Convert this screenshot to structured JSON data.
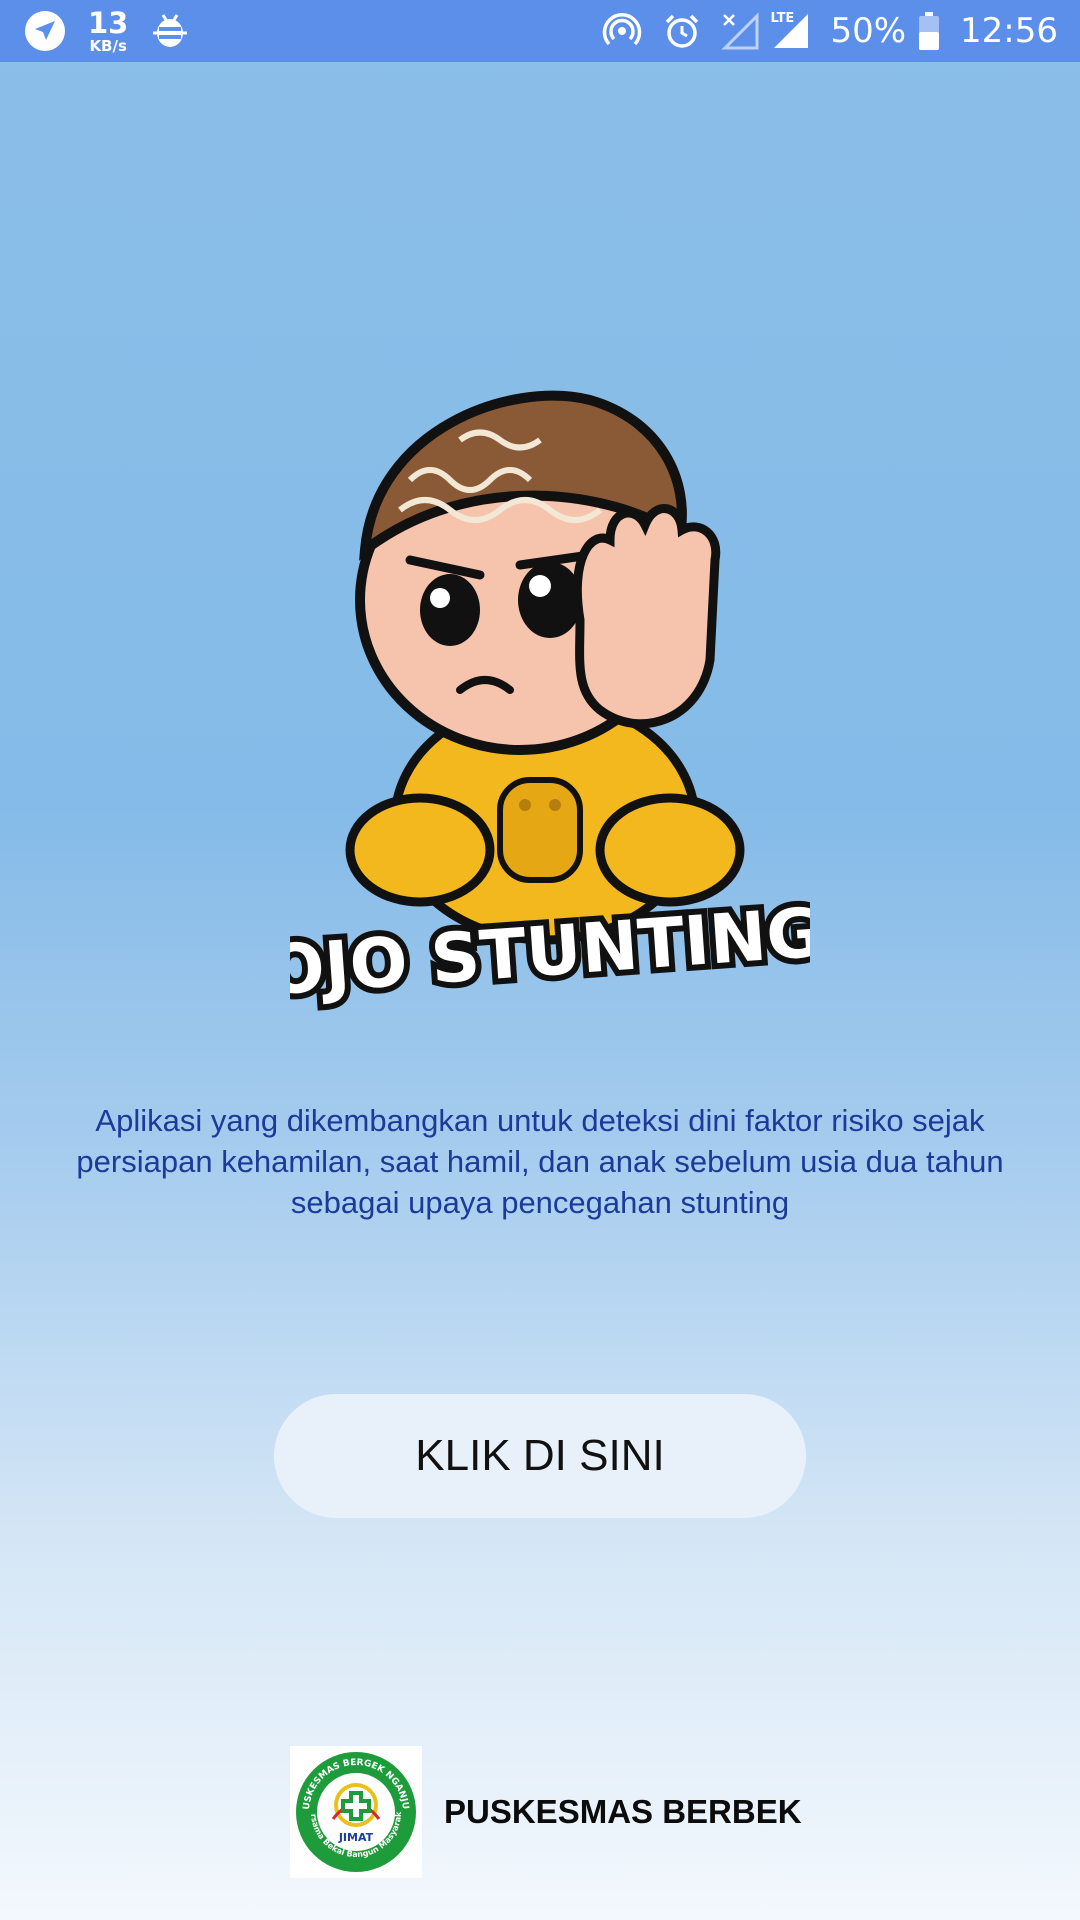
{
  "status_bar": {
    "speed_value": "13",
    "speed_unit": "KB/s",
    "battery": "50%",
    "time": "12:56",
    "network_label": "LTE",
    "icons": [
      "navigation-icon",
      "bug-icon",
      "hotspot-icon",
      "alarm-icon",
      "no-signal-icon",
      "lte-signal-icon",
      "battery-icon"
    ]
  },
  "app": {
    "logo_text": "OJO STUNTING",
    "description": "Aplikasi yang dikembangkan untuk deteksi dini faktor risiko sejak persiapan kehamilan, saat hamil, dan anak sebelum usia dua tahun sebagai upaya pencegahan stunting",
    "button_label": "KLIK DI SINI"
  },
  "footer": {
    "logo_ring_text": "PUSKESMAS BERGEK NGANJUK",
    "logo_ring_text_bottom": "Bersama Bekal Bangun Masyarakat",
    "logo_center_text": "JIMAT",
    "name": "PUSKESMAS BERBEK"
  },
  "colors": {
    "status_bar": "#5c8fea",
    "description_text": "#1c3a9a",
    "button_bg": "#e8f1fa",
    "mascot_outfit": "#f2b81e",
    "mascot_cap": "#8a5a36"
  }
}
